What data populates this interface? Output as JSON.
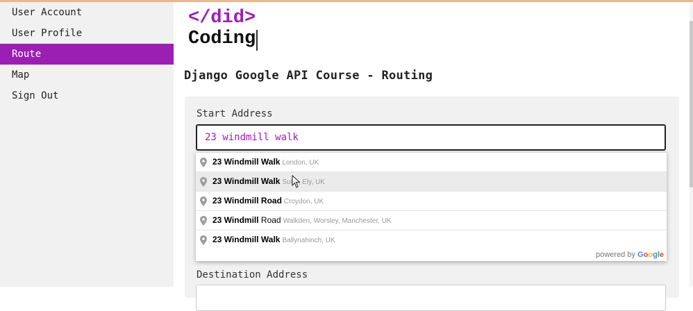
{
  "sidebar": {
    "items": [
      {
        "label": "User Account"
      },
      {
        "label": "User Profile"
      },
      {
        "label": "Route",
        "active": true
      },
      {
        "label": "Map"
      },
      {
        "label": "Sign Out"
      }
    ]
  },
  "logo": {
    "tag": "</did>",
    "name": "Coding"
  },
  "page": {
    "title": "Django Google API Course - Routing"
  },
  "form": {
    "start_label": "Start Address",
    "start_value": "23 windmill walk",
    "destination_label": "Destination Address"
  },
  "autocomplete": {
    "items": [
      {
        "main_bold": "23 Windmill Walk",
        "main_rest": "",
        "secondary": "London, UK"
      },
      {
        "main_bold": "23 Windmill Walk",
        "main_rest": "",
        "secondary": "Sut..., Ely, UK"
      },
      {
        "main_bold": "23 Windmill Road",
        "main_rest": "",
        "secondary": "Croydon, UK"
      },
      {
        "main_bold": "23 Windmill",
        "main_rest": " Road",
        "secondary": "Walkden, Worsley, Manchester, UK"
      },
      {
        "main_bold": "23 Windmill Walk",
        "main_rest": "",
        "secondary": "Ballynahinch, UK"
      }
    ],
    "powered_by": "powered by",
    "brand": "Google"
  },
  "colors": {
    "accent": "#9b1fb3",
    "sidebar_bg": "#f1f1f1",
    "panel_bg": "#f1f1f1"
  },
  "icons": {
    "pin": "map-pin-icon",
    "cursor": "mouse-cursor-icon"
  }
}
